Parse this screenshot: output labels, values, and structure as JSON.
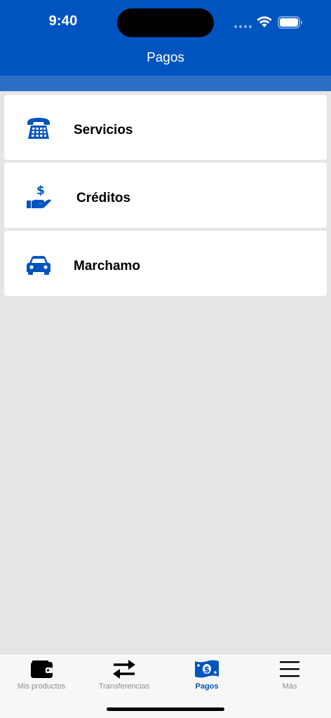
{
  "status_bar": {
    "time": "9:40"
  },
  "header": {
    "title": "Pagos"
  },
  "items": [
    {
      "label": "Servicios",
      "icon": "telephone-icon"
    },
    {
      "label": "Créditos",
      "icon": "hand-dollar-icon"
    },
    {
      "label": "Marchamo",
      "icon": "car-icon"
    }
  ],
  "tabbar": {
    "tabs": [
      {
        "label": "Mis productos",
        "icon": "wallet-icon",
        "active": false
      },
      {
        "label": "Transferencias",
        "icon": "swap-arrows-icon",
        "active": false
      },
      {
        "label": "Pagos",
        "icon": "money-bill-icon",
        "active": true
      },
      {
        "label": "Más",
        "icon": "menu-icon",
        "active": false
      }
    ]
  },
  "colors": {
    "brand_blue": "#0054c0",
    "header_sub": "#2c70c6",
    "background": "#e5e5e5",
    "tab_inactive": "#8e8e93"
  }
}
